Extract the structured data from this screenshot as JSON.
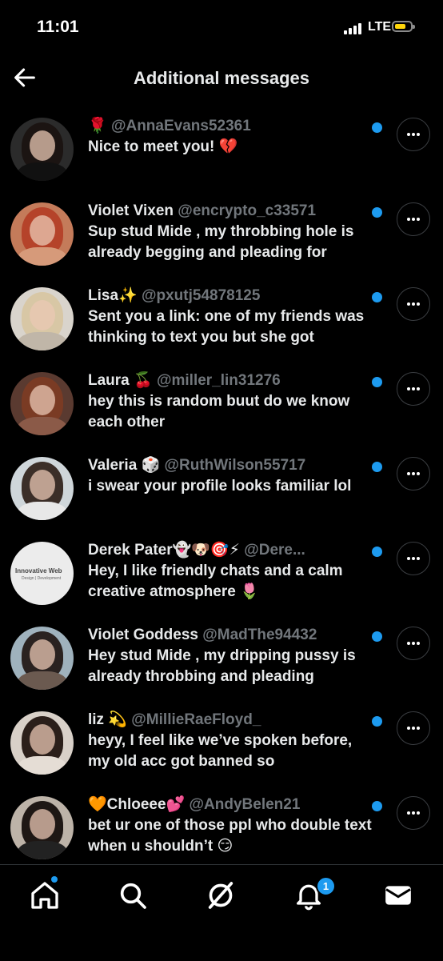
{
  "status": {
    "time": "11:01",
    "network": "LTE"
  },
  "header": {
    "title": "Additional messages"
  },
  "messages": [
    {
      "name": "🌹",
      "handle": "@AnnaEvans52361",
      "text": "Nice to meet you! 💔"
    },
    {
      "name": "Violet Vixen",
      "handle": "@encrypto_c33571",
      "text": "Sup stud Mide , my throbbing hole is already begging and pleading for"
    },
    {
      "name": "Lisa✨",
      "handle": "@pxutj54878125",
      "text": "Sent you a link: one of my friends was thinking to text you but she got"
    },
    {
      "name": "Laura 🍒",
      "handle": "@miller_lin31276",
      "text": "hey this is random buut do we know each other"
    },
    {
      "name": "Valeria 🎲",
      "handle": "@RuthWilson55717",
      "text": "i swear your profile looks familiar lol"
    },
    {
      "name": "Derek Pater👻🐶🎯⚡",
      "handle": "@Dere...",
      "text": "Hey, I like friendly chats and a calm creative atmosphere 🌷",
      "avatar_text": "Innovative Web",
      "avatar_subtext": "Design | Development"
    },
    {
      "name": "Violet Goddess",
      "handle": "@MadThe94432",
      "text": "Hey stud Mide  , my dripping pussy is already throbbing and pleading"
    },
    {
      "name": "liz 💫",
      "handle": "@MillieRaeFloyd_",
      "text": "heyy, I feel like we’ve spoken before, my old acc got banned so"
    },
    {
      "name": "🧡Chloeee💕",
      "handle": "@AndyBelen21",
      "text": "bet ur one of those ppl who double text when u shouldn’t 😏"
    }
  ],
  "tabbar": {
    "notifications_count": "1"
  },
  "colors": {
    "accent": "#1d9bf0",
    "handle": "#71767b",
    "text": "#e7e9ea",
    "background": "#000000"
  }
}
